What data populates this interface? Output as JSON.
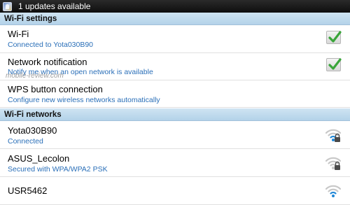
{
  "status_bar": {
    "notification_text": "1 updates available"
  },
  "wifi_settings": {
    "header": "Wi-Fi settings",
    "items": [
      {
        "title": "Wi-Fi",
        "subtitle": "Connected to Yota030B90",
        "checked": true
      },
      {
        "title": "Network notification",
        "subtitle": "Notify me when an open network is available",
        "checked": true
      },
      {
        "title": "WPS button connection",
        "subtitle": "Configure new wireless networks automatically"
      }
    ]
  },
  "wifi_networks": {
    "header": "Wi-Fi networks",
    "items": [
      {
        "ssid": "Yota030B90",
        "status": "Connected",
        "secured": true,
        "icon": "wifi-signal-lock-icon"
      },
      {
        "ssid": "ASUS_Lecolon",
        "status": "Secured with WPA/WPA2 PSK",
        "secured": true,
        "icon": "wifi-signal-lock-icon"
      },
      {
        "ssid": "USR5462",
        "status": "",
        "secured": false,
        "icon": "wifi-signal-icon"
      }
    ]
  },
  "watermark": "mobile-review.com",
  "colors": {
    "accent": "#2a6fb8",
    "check_green": "#3aa53a",
    "header_bg": "#c2dcef"
  }
}
